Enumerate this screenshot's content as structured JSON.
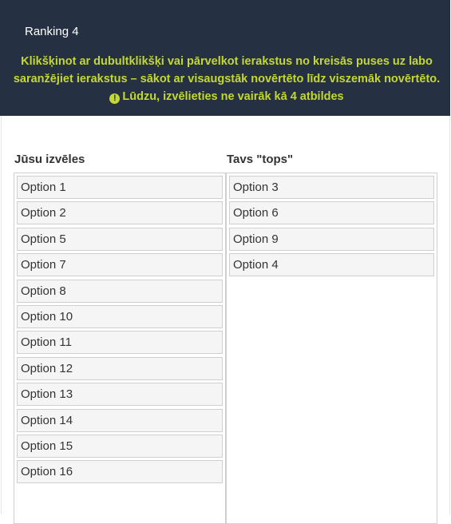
{
  "question": {
    "title": "Ranking 4",
    "help_line1": "Klikšķinot ar dubultklikšķi vai pārvelkot ierakstus no kreisās puses uz labo",
    "help_line2": "saranžējiet ierakstus – sākot ar visaugstāk novērtēto līdz viszemāk novērtēto.",
    "warning_icon": "!",
    "warning": "Lūdzu, izvēlieties ne vairāk kā 4 atbildes"
  },
  "choices": {
    "title": "Jūsu izvēles",
    "items": [
      "Option 1",
      "Option 2",
      "Option 5",
      "Option 7",
      "Option 8",
      "Option 10",
      "Option 11",
      "Option 12",
      "Option 13",
      "Option 14",
      "Option 15",
      "Option 16"
    ]
  },
  "ranked": {
    "title": "Tavs \"tops\"",
    "items": [
      "Option 3",
      "Option 6",
      "Option 9",
      "Option 4"
    ]
  }
}
